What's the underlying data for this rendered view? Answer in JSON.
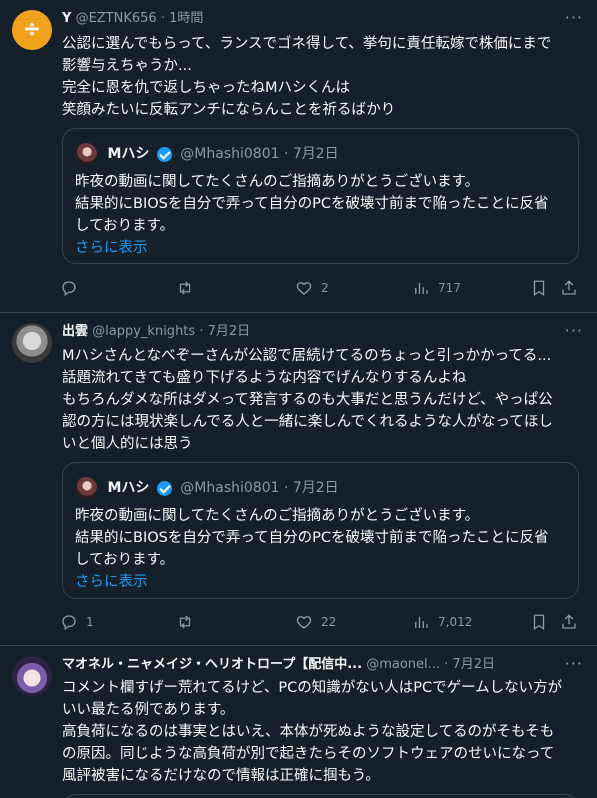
{
  "tweets": [
    {
      "name": "Y",
      "handle": "@EZTNK656",
      "time": "· 1時間",
      "avatar_char": "÷",
      "lines": [
        "公認に選んでもらって、ランスでゴネ得して、挙句に責任転嫁で株価にまで",
        "影響与えちゃうか...",
        "完全に恩を仇で返しちゃったねMハシくんは",
        "笑顔みたいに反転アンチにならんことを祈るばかり"
      ],
      "quote": {
        "name": "Mハシ",
        "handle": "@Mhashi0801",
        "time": "· 7月2日",
        "lines": [
          "昨夜の動画に関してたくさんのご指摘ありがとうございます。",
          "結果的にBIOSを自分で弄って自分のPCを破壊寸前まで陥ったことに反省",
          "しております。"
        ],
        "more": "さらに表示"
      },
      "replies": "",
      "retweets": "",
      "likes": "2",
      "views": "717"
    },
    {
      "name": "出雲",
      "handle": "@lappy_knights",
      "time": "· 7月2日",
      "lines": [
        "Mハシさんとなべぞーさんが公認で居続けてるのちょっと引っかかってる...",
        "話題流れてきても盛り下げるような内容でげんなりするんよね",
        "もちろんダメな所はダメって発言するのも大事だと思うんだけど、やっぱ公",
        "認の方には現状楽しんでる人と一緒に楽しんでくれるような人がなってほし",
        "いと個人的には思う"
      ],
      "quote": {
        "name": "Mハシ",
        "handle": "@Mhashi0801",
        "time": "· 7月2日",
        "lines": [
          "昨夜の動画に関してたくさんのご指摘ありがとうございます。",
          "結果的にBIOSを自分で弄って自分のPCを破壊寸前まで陥ったことに反省",
          "しております。"
        ],
        "more": "さらに表示"
      },
      "replies": "1",
      "retweets": "",
      "likes": "22",
      "views": "7,012"
    },
    {
      "name": "マオネル・ニャメイジ・ヘリオトロープ【配信中...",
      "handle": "@maonel...",
      "time": "· 7月2日",
      "lines": [
        "コメント欄すげー荒れてるけど、PCの知識がない人はPCでゲームしない方が",
        "いい最たる例であります。",
        "高負荷になるのは事実とはいえ、本体が死ぬような設定してるのがそもそも",
        "の原因。同じような高負荷が別で起きたらそのソフトウェアのせいになって",
        "風評被害になるだけなので情報は正確に掴もう。"
      ]
    }
  ],
  "more_icon": "···"
}
